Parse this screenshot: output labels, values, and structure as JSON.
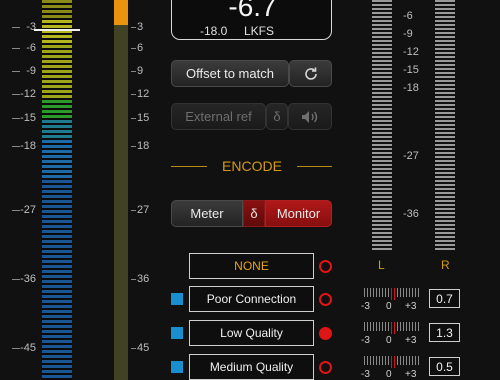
{
  "colors": {
    "accent_orange": "#e8940f",
    "encode_gold": "#d49a16",
    "monitor_red": "#a01414",
    "check_blue": "#1a8fd0"
  },
  "left_meter_scale": [
    "-3",
    "-6",
    "-9",
    "-12",
    "-15",
    "-18",
    "-27",
    "-36",
    "-45"
  ],
  "second_meter_scale": [
    "3",
    "6",
    "9",
    "12",
    "15",
    "18",
    "27",
    "36",
    "45"
  ],
  "readout": {
    "value": "-6.7",
    "reference": "-18.0",
    "unit": "LKFS"
  },
  "buttons": {
    "offset_to_match": "Offset to match",
    "refresh_icon": "refresh-icon",
    "external_ref": "External ref",
    "delta_small": "δ",
    "speaker_icon": "speaker-icon"
  },
  "encode": {
    "title": "ENCODE",
    "meter": "Meter",
    "delta": "δ",
    "monitor": "Monitor"
  },
  "quality_list": [
    {
      "label": "NONE",
      "checked": false,
      "selected": false
    },
    {
      "label": "Poor Connection",
      "checked": true,
      "selected": false
    },
    {
      "label": "Low Quality",
      "checked": true,
      "selected": true
    },
    {
      "label": "Medium Quality",
      "checked": true,
      "selected": false
    }
  ],
  "right_meter_scale": [
    "-6",
    "-9",
    "-12",
    "-15",
    "-18",
    "-27",
    "-36"
  ],
  "channels": {
    "left": "L",
    "right": "R"
  },
  "mini_scale": [
    "-3",
    "0",
    "+3"
  ],
  "mini_values": [
    "0.7",
    "1.3",
    "0.5"
  ]
}
